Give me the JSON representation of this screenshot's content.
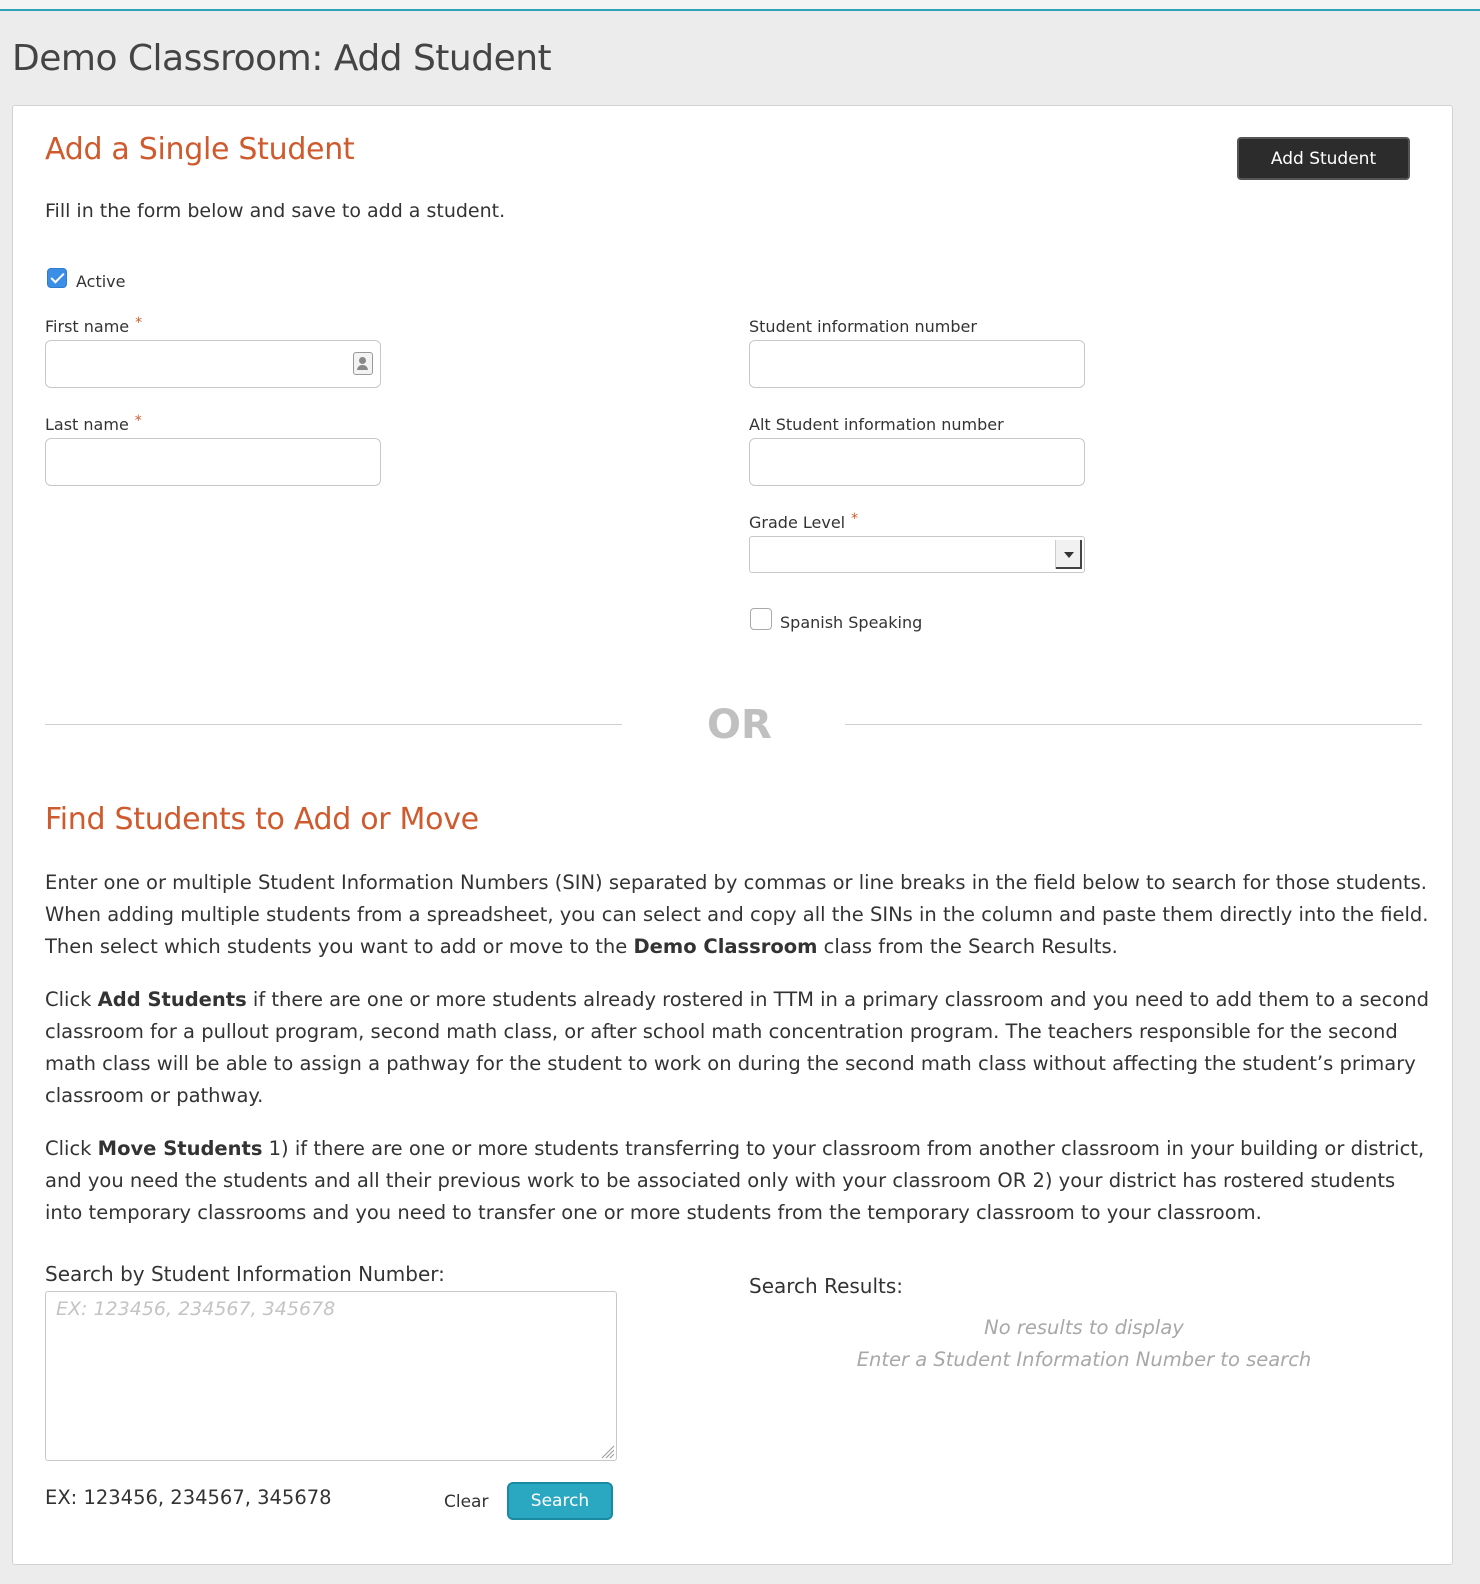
{
  "page": {
    "title": "Demo Classroom: Add Student"
  },
  "single": {
    "title": "Add a Single Student",
    "add_button": "Add Student",
    "intro": "Fill in the form below and save to add a student.",
    "active_label": "Active",
    "active_checked": true,
    "first_name_label": "First name",
    "last_name_label": "Last name",
    "required_mark": "*",
    "sin_label": "Student information number",
    "alt_sin_label": "Alt Student information number",
    "grade_label": "Grade Level",
    "grade_value": "",
    "spanish_label": "Spanish Speaking",
    "spanish_checked": false
  },
  "divider": {
    "or_text": "OR"
  },
  "find": {
    "title": "Find Students to Add or Move",
    "p1_a": "Enter one or multiple Student Information Numbers (SIN) separated by commas or line breaks in the field below to search for those students. When adding multiple students from a spreadsheet, you can select and copy all the SINs in the column and paste them directly into the field. Then select which students you want to add or move to the ",
    "p1_bold": "Demo Classroom",
    "p1_b": " class from the Search Results.",
    "p2_pre": "Click ",
    "p2_bold": "Add Students",
    "p2_rest": " if there are one or more students already rostered in TTM in a primary classroom and you need to add them to a second classroom for a pullout program, second math class, or after school math concentration program. The teachers responsible for the second math class will be able to assign a pathway for the student to work on during the second math class without affecting the student’s primary classroom or pathway.",
    "p3_pre": "Click ",
    "p3_bold": "Move Students",
    "p3_rest": " 1) if there are one or more students transferring to your classroom from another classroom in your building or district, and you need the students and all their previous work to be associated only with your classroom OR 2) your district has rostered students into temporary classrooms and you need to transfer one or more students from the temporary classroom to your classroom.",
    "search_label": "Search by Student Information Number:",
    "search_placeholder": "EX: 123456, 234567, 345678",
    "example": "EX: 123456, 234567, 345678",
    "clear_label": "Clear",
    "search_button": "Search",
    "results_label": "Search Results:",
    "results_empty_1": "No results to display",
    "results_empty_2": "Enter a Student Information Number to search"
  },
  "colors": {
    "accent": "#cf5a2e",
    "button_dark": "#2c2c2c",
    "button_teal": "#2aa8c2",
    "checkbox": "#3a8ee6"
  }
}
